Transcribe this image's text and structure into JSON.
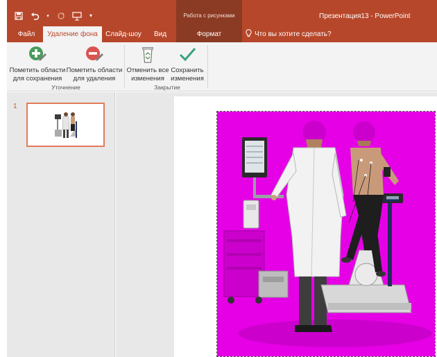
{
  "window": {
    "contextual_group": "Работа с рисунками",
    "document_title": "Презентация13  -  PowerPoint"
  },
  "quick_access": [
    "save-icon",
    "undo-icon",
    "undo-dropdown-icon",
    "redo-icon",
    "present-from-start-icon",
    "customize-qat-icon"
  ],
  "tabs": [
    {
      "label": "Файл"
    },
    {
      "label": "Удаление фона"
    },
    {
      "label": "Слайд-шоу"
    },
    {
      "label": "Вид"
    },
    {
      "label": "Формат"
    }
  ],
  "tell_me": {
    "label": "Что вы хотите сделать?"
  },
  "ribbon": {
    "groups": [
      {
        "label": "Уточнение",
        "buttons": [
          {
            "line1": "Пометить области",
            "line2": "для сохранения"
          },
          {
            "line1": "Пометить области",
            "line2": "для удаления"
          }
        ]
      },
      {
        "label": "Закрытие",
        "buttons": [
          {
            "line1": "Отменить все",
            "line2": "изменения"
          },
          {
            "line1": "Сохранить",
            "line2": "изменения"
          }
        ]
      }
    ]
  },
  "slides_pane": {
    "slide_number": "1"
  },
  "colors": {
    "ribbon_accent": "#b7472a",
    "contextual_tab": "#8b3a23",
    "removal_overlay": "#e600e6",
    "keep_icon": "#4a9a5c",
    "remove_icon": "#d9534f",
    "save_check": "#3aa37a"
  }
}
